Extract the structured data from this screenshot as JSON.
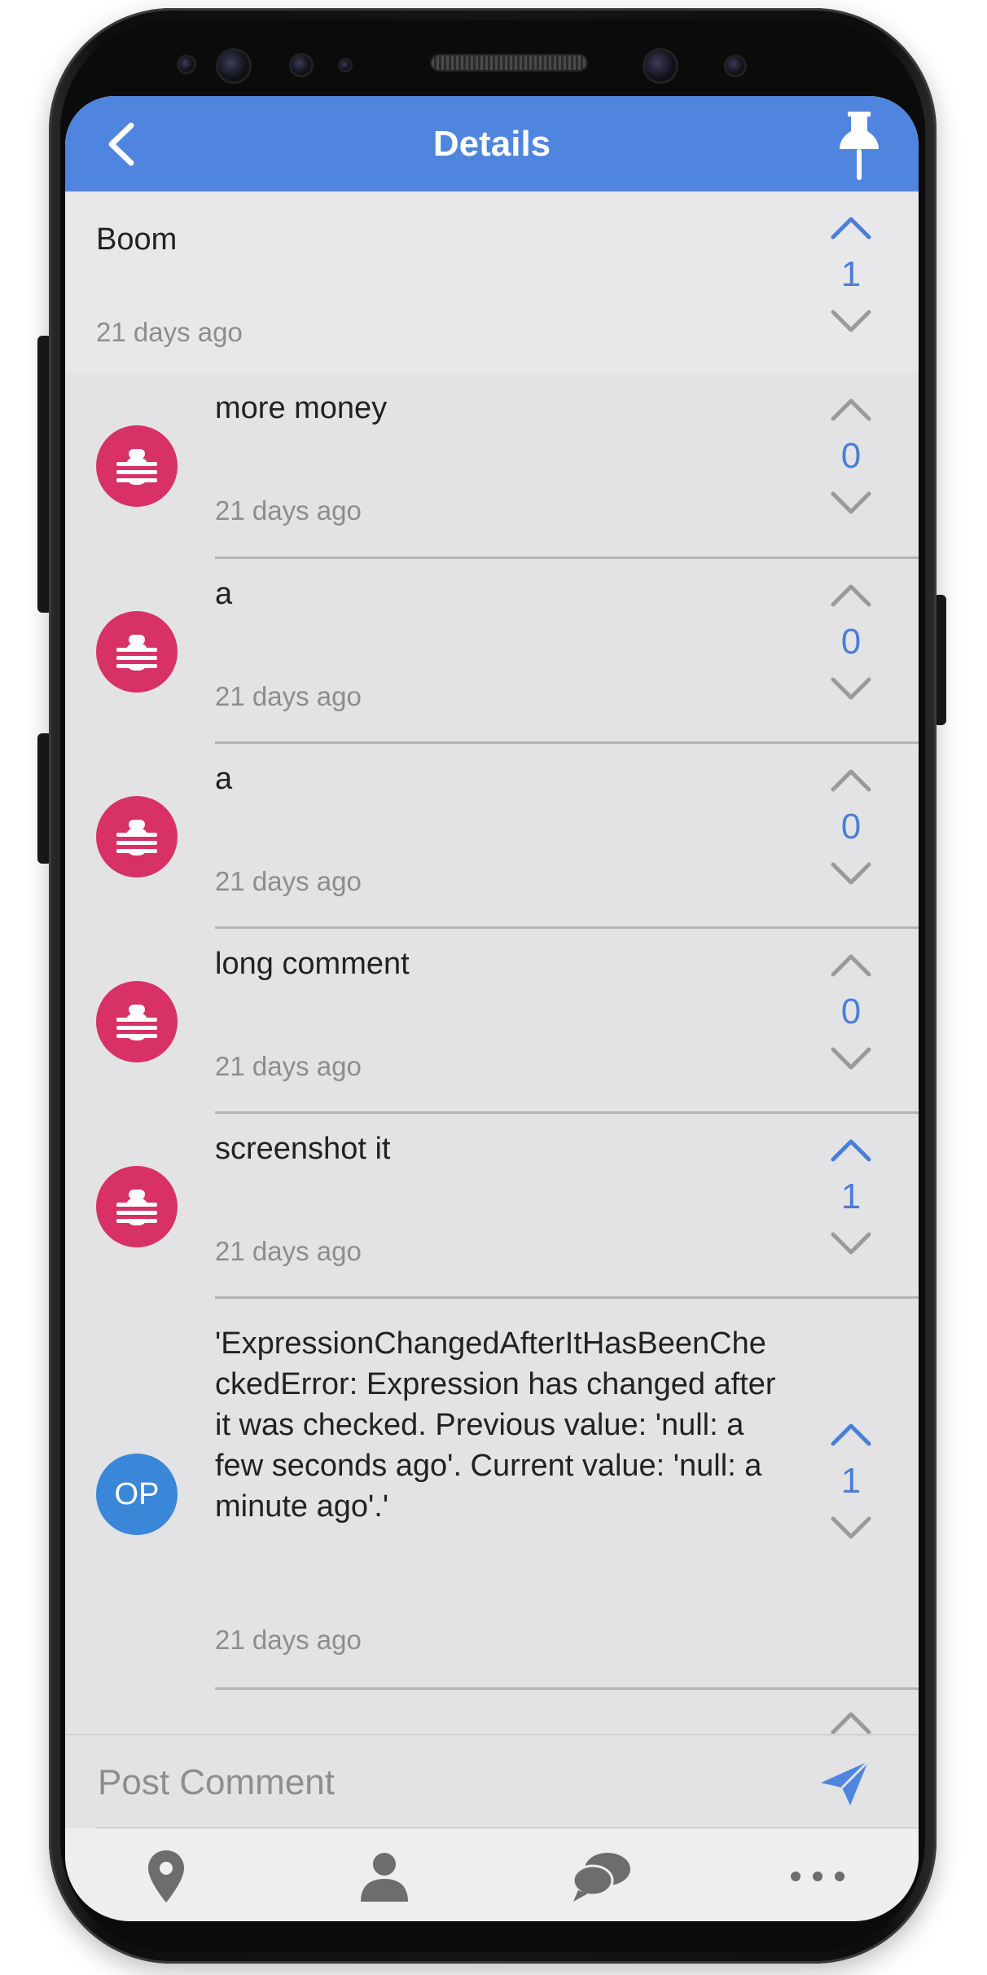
{
  "header": {
    "title": "Details",
    "back_icon": "chevron-left-icon",
    "pin_icon": "pushpin-icon",
    "background_color": "#4f85df"
  },
  "post": {
    "text": "Boom",
    "time": "21 days ago",
    "votes": "1",
    "upvoted": true
  },
  "comments": [
    {
      "avatar": "bug-icon",
      "text": "more money",
      "time": "21 days ago",
      "votes": "0",
      "upvoted": false
    },
    {
      "avatar": "bug-icon",
      "text": "a",
      "time": "21 days ago",
      "votes": "0",
      "upvoted": false
    },
    {
      "avatar": "bug-icon",
      "text": "a",
      "time": "21 days ago",
      "votes": "0",
      "upvoted": false
    },
    {
      "avatar": "bug-icon",
      "text": "long comment",
      "time": "21 days ago",
      "votes": "0",
      "upvoted": false
    },
    {
      "avatar": "bug-icon",
      "text": "screenshot it",
      "time": "21 days ago",
      "votes": "1",
      "upvoted": true
    },
    {
      "avatar": "OP",
      "text": "'ExpressionChangedAfterItHasBeenCheckedError: Expression has changed after it was checked. Previous value: 'null: a few seconds ago'. Current value: 'null: a minute ago'.'",
      "time": "21 days ago",
      "votes": "1",
      "upvoted": true
    }
  ],
  "composer": {
    "placeholder": "Post Comment",
    "send_icon": "send-icon"
  },
  "tabs": [
    {
      "icon": "map-pin-icon"
    },
    {
      "icon": "user-icon"
    },
    {
      "icon": "chat-bubbles-icon"
    },
    {
      "icon": "more-dots-icon"
    }
  ],
  "colors": {
    "accent": "#4f85df",
    "vote_count": "#4a7fd6",
    "bug_avatar": "#d83166",
    "op_avatar": "#3a86d9"
  }
}
